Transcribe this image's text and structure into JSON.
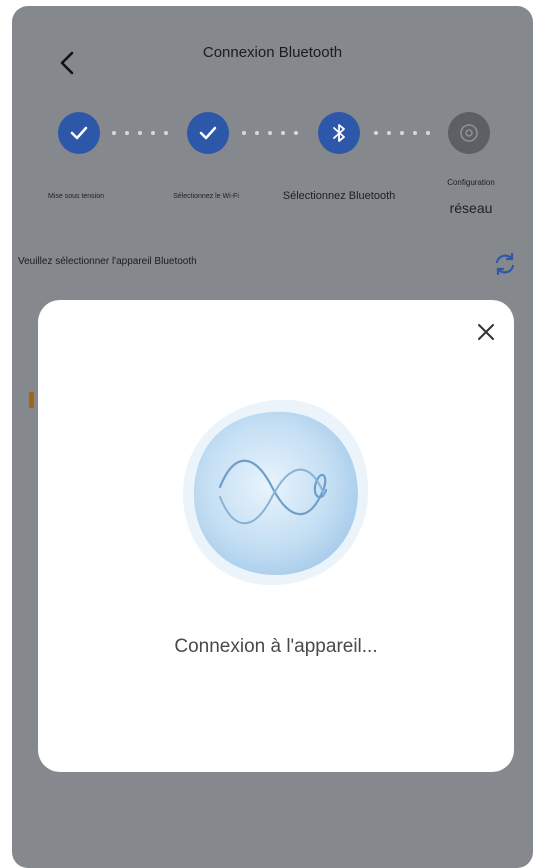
{
  "header": {
    "title": "Connexion Bluetooth"
  },
  "steps": [
    {
      "label": "Mise sous tension",
      "state": "done",
      "icon": "check-icon"
    },
    {
      "label": "Sélectionnez le Wi-Fi",
      "state": "done",
      "icon": "check-icon"
    },
    {
      "label": "Sélectionnez Bluetooth",
      "state": "active",
      "icon": "bluetooth-icon"
    },
    {
      "label_line1": "Configuration",
      "label_line2": "réseau",
      "state": "pending",
      "icon": "network-config-icon"
    }
  ],
  "main": {
    "subtitle": "Veuillez sélectionner l'appareil Bluetooth"
  },
  "modal": {
    "status_text": "Connexion à l'appareil..."
  },
  "colors": {
    "overlay": "#85888d",
    "accent": "#2d57a8",
    "pending": "#5c5f63",
    "refresh": "#2d57a8",
    "orb": "#bcd9f1"
  }
}
